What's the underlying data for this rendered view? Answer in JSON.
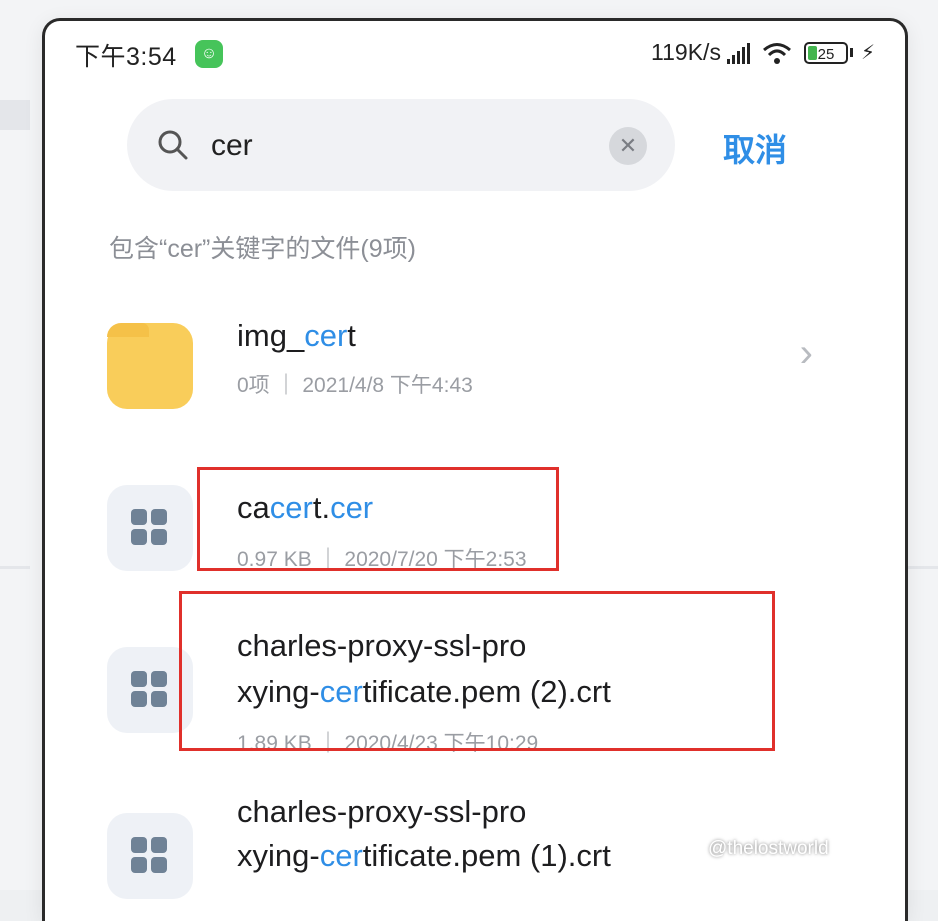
{
  "status_bar": {
    "time": "下午3:54",
    "speed": "119K/s",
    "battery": "25"
  },
  "search": {
    "query": "cer",
    "cancel_label": "取消"
  },
  "result_header": "包含“cer”关键字的文件(9项)",
  "items": [
    {
      "name_parts": [
        "img_",
        "cer",
        "t"
      ],
      "meta": "0项 ｜ 2021/4/8 下午4:43",
      "kind": "folder"
    },
    {
      "name_parts": [
        "ca",
        "cer",
        "t.",
        "cer"
      ],
      "meta": "0.97 KB ｜ 2020/7/20 下午2:53",
      "kind": "file"
    },
    {
      "line1": "charles-proxy-ssl-pro",
      "line2_parts": [
        "xying-",
        "cer",
        "tificate.pem (2).crt"
      ],
      "meta": "1.89 KB ｜ 2020/4/23 下午10:29",
      "kind": "file"
    },
    {
      "line1": "charles-proxy-ssl-pro",
      "line2_parts": [
        "xying-",
        "cer",
        "tificate.pem (1).crt"
      ],
      "kind": "file"
    }
  ],
  "watermark": "@thelostworld",
  "colors": {
    "accent": "#2f8ee6",
    "highlight_box": "#e0302b",
    "folder": "#f9cd5a"
  }
}
